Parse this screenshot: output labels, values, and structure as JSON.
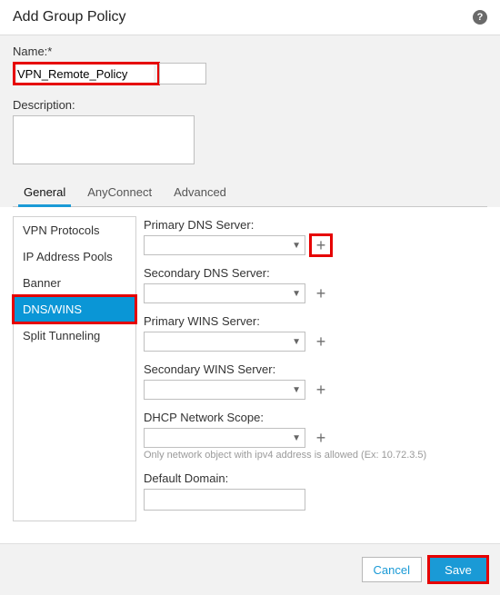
{
  "dialog": {
    "title": "Add Group Policy",
    "help_icon": "?"
  },
  "fields": {
    "name_label": "Name:*",
    "name_value": "VPN_Remote_Policy",
    "description_label": "Description:",
    "description_value": ""
  },
  "tabs": [
    {
      "label": "General",
      "active": true
    },
    {
      "label": "AnyConnect",
      "active": false
    },
    {
      "label": "Advanced",
      "active": false
    }
  ],
  "sidebar": {
    "items": [
      {
        "label": "VPN Protocols",
        "active": false
      },
      {
        "label": "IP Address Pools",
        "active": false
      },
      {
        "label": "Banner",
        "active": false
      },
      {
        "label": "DNS/WINS",
        "active": true
      },
      {
        "label": "Split Tunneling",
        "active": false
      }
    ]
  },
  "form": {
    "primary_dns_label": "Primary DNS Server:",
    "primary_dns_value": "",
    "secondary_dns_label": "Secondary DNS Server:",
    "secondary_dns_value": "",
    "primary_wins_label": "Primary WINS Server:",
    "primary_wins_value": "",
    "secondary_wins_label": "Secondary WINS Server:",
    "secondary_wins_value": "",
    "dhcp_scope_label": "DHCP Network Scope:",
    "dhcp_scope_value": "",
    "dhcp_hint": "Only network object with ipv4 address is allowed (Ex: 10.72.3.5)",
    "default_domain_label": "Default Domain:",
    "default_domain_value": "",
    "plus_glyph": "+",
    "caret_glyph": "▼"
  },
  "footer": {
    "cancel_label": "Cancel",
    "save_label": "Save"
  }
}
